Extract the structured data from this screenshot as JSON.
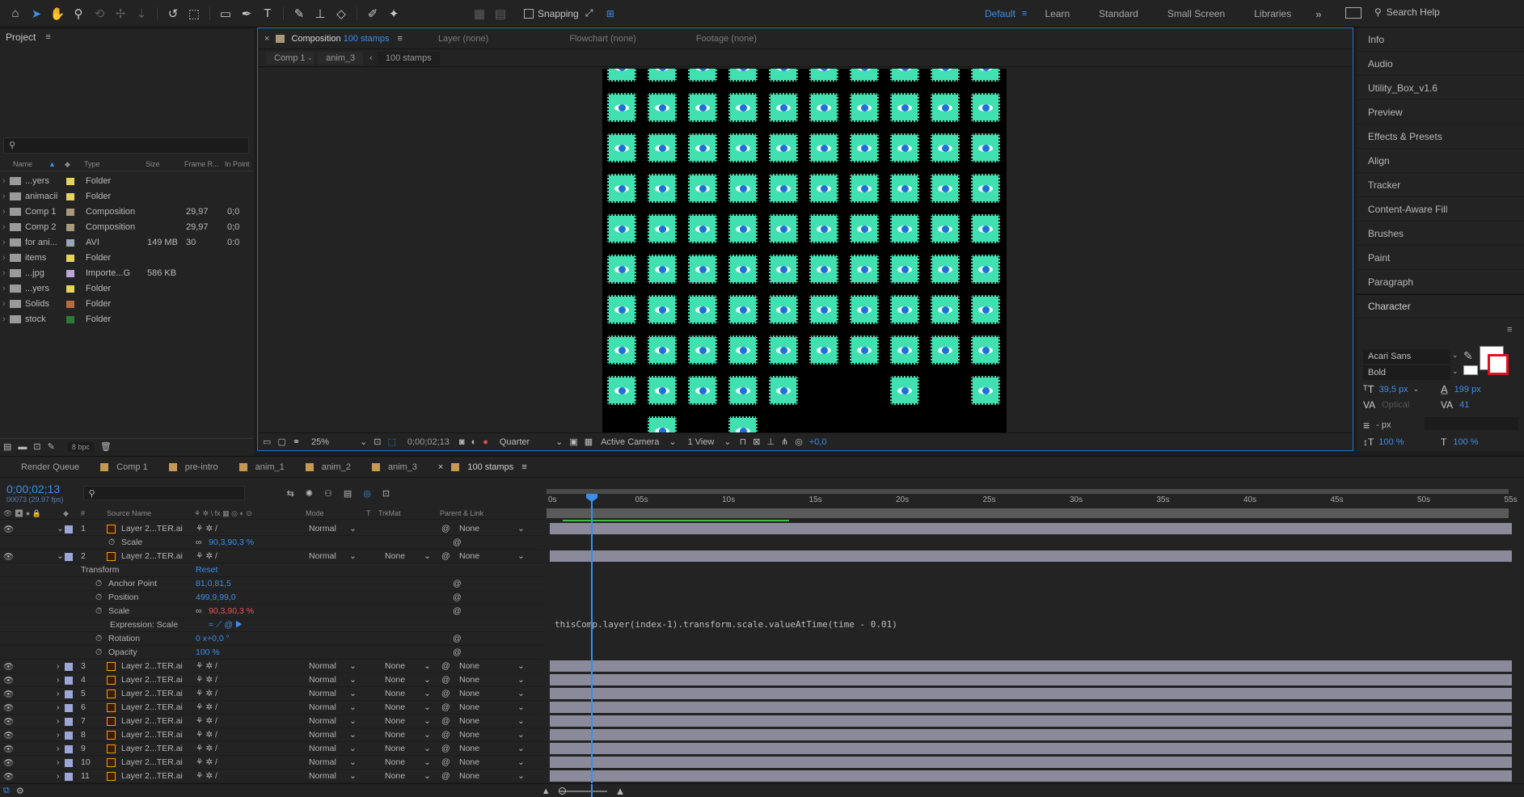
{
  "toolbar": {
    "snapping_label": "Snapping",
    "workspaces": [
      "Default",
      "Learn",
      "Standard",
      "Small Screen",
      "Libraries"
    ],
    "active_workspace": "Default",
    "search_label": "Search Help"
  },
  "project": {
    "title": "Project",
    "columns": [
      "Name",
      "Type",
      "Size",
      "Frame R...",
      "In Point"
    ],
    "items": [
      {
        "name": "...yers",
        "type": "Folder",
        "size": "",
        "fps": "",
        "in": "",
        "color": "#e6d35c"
      },
      {
        "name": "animacii",
        "type": "Folder",
        "size": "",
        "fps": "",
        "in": "",
        "color": "#e6d35c"
      },
      {
        "name": "Comp 1",
        "type": "Composition",
        "size": "",
        "fps": "29,97",
        "in": "0;0",
        "color": "#a8997a"
      },
      {
        "name": "Comp 2",
        "type": "Composition",
        "size": "",
        "fps": "29,97",
        "in": "0;0",
        "color": "#a8997a"
      },
      {
        "name": "for ani...",
        "type": "AVI",
        "size": "149 MB",
        "fps": "30",
        "in": "0:0",
        "color": "#9aa6b8"
      },
      {
        "name": "items",
        "type": "Folder",
        "size": "",
        "fps": "",
        "in": "",
        "color": "#e6d35c"
      },
      {
        "name": "...jpg",
        "type": "Importe...G",
        "size": "586 KB",
        "fps": "",
        "in": "",
        "color": "#b9a6d6"
      },
      {
        "name": "...yers",
        "type": "Folder",
        "size": "",
        "fps": "",
        "in": "",
        "color": "#e6d35c"
      },
      {
        "name": "Solids",
        "type": "Folder",
        "size": "",
        "fps": "",
        "in": "",
        "color": "#b96b3a"
      },
      {
        "name": "stock",
        "type": "Folder",
        "size": "",
        "fps": "",
        "in": "",
        "color": "#2e7a3a"
      }
    ],
    "bpc": "8 bpc"
  },
  "viewer": {
    "tab_comp_prefix": "Composition",
    "tab_comp_name": "100 stamps",
    "tab_layer": "Layer (none)",
    "tab_flowchart": "Flowchart (none)",
    "tab_footage": "Footage (none)",
    "crumbs": [
      "Comp 1",
      "anim_3",
      "100 stamps"
    ],
    "zoom": "25%",
    "timecode": "0;00;02;13",
    "resolution": "Quarter",
    "camera": "Active Camera",
    "views": "1 View",
    "exposure": "+0,0"
  },
  "right_panel": {
    "items": [
      "Info",
      "Audio",
      "Utility_Box_v1.6",
      "Preview",
      "Effects & Presets",
      "Align",
      "Tracker",
      "Content-Aware Fill",
      "Brushes",
      "Paint",
      "Paragraph",
      "Character"
    ],
    "font": "Acari Sans",
    "style": "Bold",
    "font_size": "39,5 px",
    "leading": "199 px",
    "kerning": "Optical",
    "tracking": "41",
    "stroke": "- px",
    "vscale": "100 %",
    "hscale": "100 %"
  },
  "timeline": {
    "tabs": [
      "Render Queue",
      "Comp 1",
      "pre-intro",
      "anim_1",
      "anim_2",
      "anim_3",
      "100 stamps"
    ],
    "active_tab": "100 stamps",
    "timecode": "0;00;02;13",
    "frames": "00073 (29.97 fps)",
    "headers": {
      "source": "Source Name",
      "mode": "Mode",
      "t": "T",
      "trkmat": "TrkMat",
      "parent": "Parent & Link"
    },
    "ruler": [
      "0s",
      "05s",
      "10s",
      "15s",
      "20s",
      "25s",
      "30s",
      "35s",
      "40s",
      "45s",
      "50s",
      "55s"
    ],
    "layer1": {
      "num": "1",
      "name": "Layer 2...TER.ai",
      "mode": "Normal",
      "parent": "None"
    },
    "scale1": {
      "label": "Scale",
      "value": "90,3,90,3 %"
    },
    "layer2": {
      "num": "2",
      "name": "Layer 2...TER.ai",
      "mode": "Normal",
      "trkmat": "None",
      "parent": "None"
    },
    "transform": {
      "label": "Transform",
      "reset": "Reset"
    },
    "props": [
      {
        "label": "Anchor Point",
        "value": "81,0,81,5"
      },
      {
        "label": "Position",
        "value": "499,9,99,0"
      },
      {
        "label": "Scale",
        "value": "90,3,90,3 %"
      },
      {
        "label": "Rotation",
        "value": "0 x+0,0 °"
      },
      {
        "label": "Opacity",
        "value": "100 %"
      }
    ],
    "expr_label": "Expression: Scale",
    "expression": "thisComp.layer(index-1).transform.scale.valueAtTime(time - 0.01)",
    "rows": [
      {
        "num": "3",
        "name": "Layer 2...TER.ai",
        "mode": "Normal",
        "trkmat": "None",
        "parent": "None"
      },
      {
        "num": "4",
        "name": "Layer 2...TER.ai",
        "mode": "Normal",
        "trkmat": "None",
        "parent": "None"
      },
      {
        "num": "5",
        "name": "Layer 2...TER.ai",
        "mode": "Normal",
        "trkmat": "None",
        "parent": "None"
      },
      {
        "num": "6",
        "name": "Layer 2...TER.ai",
        "mode": "Normal",
        "trkmat": "None",
        "parent": "None"
      },
      {
        "num": "7",
        "name": "Layer 2...TER.ai",
        "mode": "Normal",
        "trkmat": "None",
        "parent": "None"
      },
      {
        "num": "8",
        "name": "Layer 2...TER.ai",
        "mode": "Normal",
        "trkmat": "None",
        "parent": "None"
      },
      {
        "num": "9",
        "name": "Layer 2...TER.ai",
        "mode": "Normal",
        "trkmat": "None",
        "parent": "None"
      },
      {
        "num": "10",
        "name": "Layer 2...TER.ai",
        "mode": "Normal",
        "trkmat": "None",
        "parent": "None"
      },
      {
        "num": "11",
        "name": "Layer 2...TER.ai",
        "mode": "Normal",
        "trkmat": "None",
        "parent": "None"
      }
    ]
  },
  "colors": {
    "accent": "#3b8eea",
    "stamp": "#40e0b0",
    "layer_bar": "#8a8a9a",
    "layer_label": "#9da6d9"
  }
}
